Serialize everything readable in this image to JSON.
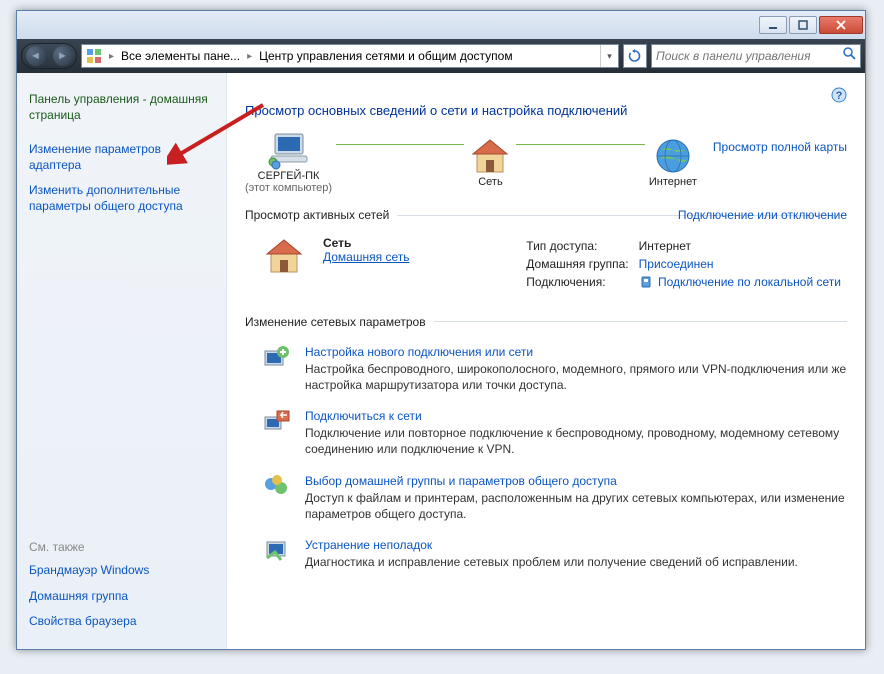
{
  "breadcrumb": {
    "seg1": "Все элементы пане...",
    "seg2": "Центр управления сетями и общим доступом"
  },
  "search": {
    "placeholder": "Поиск в панели управления"
  },
  "leftnav": {
    "home": "Панель управления - домашняя страница",
    "link1": "Изменение параметров адаптера",
    "link2": "Изменить дополнительные параметры общего доступа",
    "see_also": "См. также",
    "bottom1": "Брандмауэр Windows",
    "bottom2": "Домашняя группа",
    "bottom3": "Свойства браузера"
  },
  "main": {
    "title": "Просмотр основных сведений о сети и настройка подключений",
    "full_map": "Просмотр полной карты",
    "node_pc": "СЕРГЕЙ-ПК",
    "node_pc_sub": "(этот компьютер)",
    "node_net": "Сеть",
    "node_inet": "Интернет",
    "active_legend": "Просмотр активных сетей",
    "connect_link": "Подключение или отключение",
    "net_name": "Сеть",
    "net_type": "Домашняя сеть",
    "prop_access_label": "Тип доступа:",
    "prop_access_value": "Интернет",
    "prop_group_label": "Домашняя группа:",
    "prop_group_value": "Присоединен",
    "prop_conn_label": "Подключения:",
    "prop_conn_value": "Подключение по локальной сети",
    "change_legend": "Изменение сетевых параметров",
    "task1_title": "Настройка нового подключения или сети",
    "task1_desc": "Настройка беспроводного, широкополосного, модемного, прямого или VPN-подключения или же настройка маршрутизатора или точки доступа.",
    "task2_title": "Подключиться к сети",
    "task2_desc": "Подключение или повторное подключение к беспроводному, проводному, модемному сетевому соединению или подключение к VPN.",
    "task3_title": "Выбор домашней группы и параметров общего доступа",
    "task3_desc": "Доступ к файлам и принтерам, расположенным на других сетевых компьютерах, или изменение параметров общего доступа.",
    "task4_title": "Устранение неполадок",
    "task4_desc": "Диагностика и исправление сетевых проблем или получение сведений об исправлении."
  }
}
